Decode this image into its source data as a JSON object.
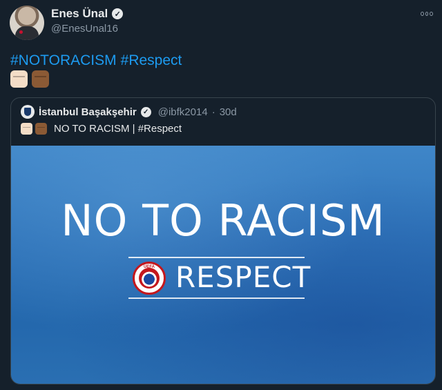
{
  "author": {
    "display_name": "Enes Ünal",
    "handle": "@EnesUnal16",
    "verified_icon": "verified-badge-icon"
  },
  "tweet": {
    "hashtags": [
      "#NOTORACISM",
      "#Respect"
    ],
    "emojis": [
      "fist-light-skin",
      "fist-dark-skin"
    ]
  },
  "quoted": {
    "display_name": "İstanbul Başakşehir",
    "handle": "@ibfk2014",
    "separator": "·",
    "time": "30d",
    "text": "NO TO RACISM | #Respect",
    "image": {
      "headline": "NO TO RACISM",
      "badge_label": "UEFA",
      "subline": "RESPECT"
    }
  },
  "colors": {
    "background": "#15202b",
    "hashtag": "#1d9bf0",
    "muted": "#8b98a5",
    "border": "#38444d",
    "image_blue": "#2f74ba",
    "uefa_red": "#c4171d"
  }
}
